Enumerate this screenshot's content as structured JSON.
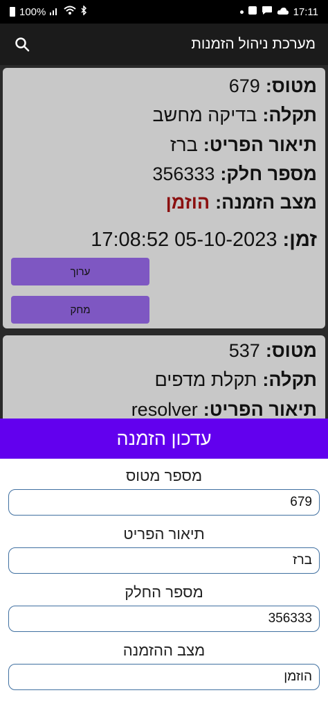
{
  "status_bar": {
    "battery": "100%",
    "time": "17:11"
  },
  "app_bar": {
    "title": "מערכת ניהול הזמנות"
  },
  "orders": [
    {
      "flight_label": "מטוס:",
      "flight": "679",
      "fault_label": "תקלה:",
      "fault": "בדיקה מחשב",
      "item_label": "תיאור הפריט:",
      "item": "ברז",
      "part_label": "מספר חלק:",
      "part": "356333",
      "status_label": "מצב הזמנה:",
      "status": "הוזמן",
      "time_label": "זמן:",
      "time": "05-10-2023 17:08:52",
      "edit_label": "ערוך",
      "delete_label": "מחק"
    },
    {
      "flight_label": "מטוס:",
      "flight": "537",
      "fault_label": "תקלה:",
      "fault": "תקלת מדפים",
      "item_label": "תיאור הפריט:",
      "item": "resolver"
    }
  ],
  "dialog": {
    "title": "עדכון הזמנה",
    "fields": [
      {
        "label": "מספר מטוס",
        "value": "679"
      },
      {
        "label": "תיאור הפריט",
        "value": "ברז"
      },
      {
        "label": "מספר החלק",
        "value": "356333"
      },
      {
        "label": "מצב ההזמנה",
        "value": "הוזמן"
      }
    ]
  },
  "colors": {
    "accent": "#6200ee",
    "button": "#7e57c2",
    "status": "#8b1010"
  }
}
